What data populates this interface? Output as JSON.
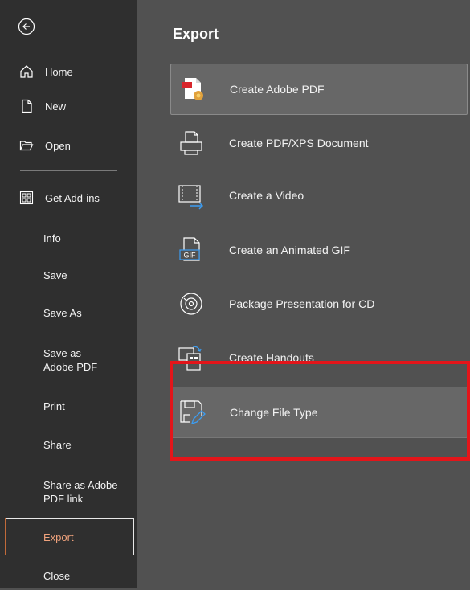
{
  "sidebar": {
    "back_icon": "back-arrow-circle-icon",
    "items": [
      {
        "label": "Home",
        "icon": "home-icon"
      },
      {
        "label": "New",
        "icon": "new-document-icon"
      },
      {
        "label": "Open",
        "icon": "open-folder-icon"
      },
      {
        "label": "Get Add-ins",
        "icon": "addins-grid-icon"
      },
      {
        "label": "Info"
      },
      {
        "label": "Save"
      },
      {
        "label": "Save As"
      },
      {
        "label": "Save as Adobe PDF"
      },
      {
        "label": "Print"
      },
      {
        "label": "Share"
      },
      {
        "label": "Share as Adobe PDF link"
      },
      {
        "label": "Export",
        "selected": true
      },
      {
        "label": "Close"
      }
    ]
  },
  "main": {
    "title": "Export",
    "options": [
      {
        "label": "Create Adobe PDF",
        "icon": "adobe-pdf-icon"
      },
      {
        "label": "Create PDF/XPS Document",
        "icon": "printer-document-icon"
      },
      {
        "label": "Create a Video",
        "icon": "video-film-icon"
      },
      {
        "label": "Create an Animated GIF",
        "icon": "gif-file-icon"
      },
      {
        "label": "Package Presentation for CD",
        "icon": "cd-disc-icon"
      },
      {
        "label": "Create Handouts",
        "icon": "handouts-icon"
      },
      {
        "label": "Change File Type",
        "icon": "change-file-type-icon"
      }
    ]
  },
  "colors": {
    "sidebar_bg": "#2f2f2f",
    "main_bg": "#515151",
    "selected_text": "#f0a27c",
    "highlight_border": "#e3151a"
  }
}
